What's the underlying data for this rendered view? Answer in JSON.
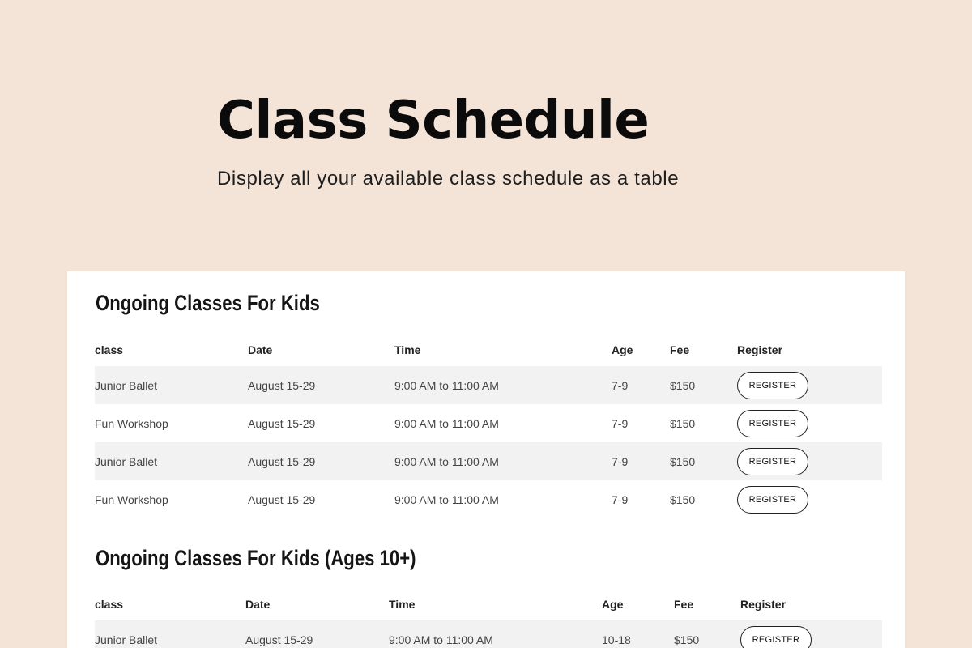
{
  "hero": {
    "title": "Class Schedule",
    "subtitle": "Display all your available class schedule as a table"
  },
  "sections": [
    {
      "title": "Ongoing Classes For Kids",
      "headers": [
        "class",
        "Date",
        "Time",
        "Age",
        "Fee",
        "Register"
      ],
      "rows": [
        {
          "class": "Junior Ballet",
          "date": "August 15-29",
          "time": "9:00 AM to 11:00 AM",
          "age": "7-9",
          "fee": "$150",
          "button": "REGISTER"
        },
        {
          "class": "Fun Workshop",
          "date": "August 15-29",
          "time": "9:00 AM to 11:00 AM",
          "age": "7-9",
          "fee": "$150",
          "button": "REGISTER"
        },
        {
          "class": "Junior Ballet",
          "date": "August 15-29",
          "time": "9:00 AM to 11:00 AM",
          "age": "7-9",
          "fee": "$150",
          "button": "REGISTER"
        },
        {
          "class": "Fun Workshop",
          "date": "August 15-29",
          "time": "9:00 AM to 11:00 AM",
          "age": "7-9",
          "fee": "$150",
          "button": "REGISTER"
        }
      ]
    },
    {
      "title": "Ongoing Classes For Kids (Ages 10+)",
      "headers": [
        "class",
        "Date",
        "Time",
        "Age",
        "Fee",
        "Register"
      ],
      "rows": [
        {
          "class": "Junior Ballet",
          "date": "August 15-29",
          "time": "9:00 AM to 11:00 AM",
          "age": "10-18",
          "fee": "$150",
          "button": "REGISTER"
        }
      ]
    }
  ],
  "colors": {
    "page_background": "#f4e3d7",
    "card_background": "#ffffff",
    "row_shade": "#f2f2f2"
  }
}
